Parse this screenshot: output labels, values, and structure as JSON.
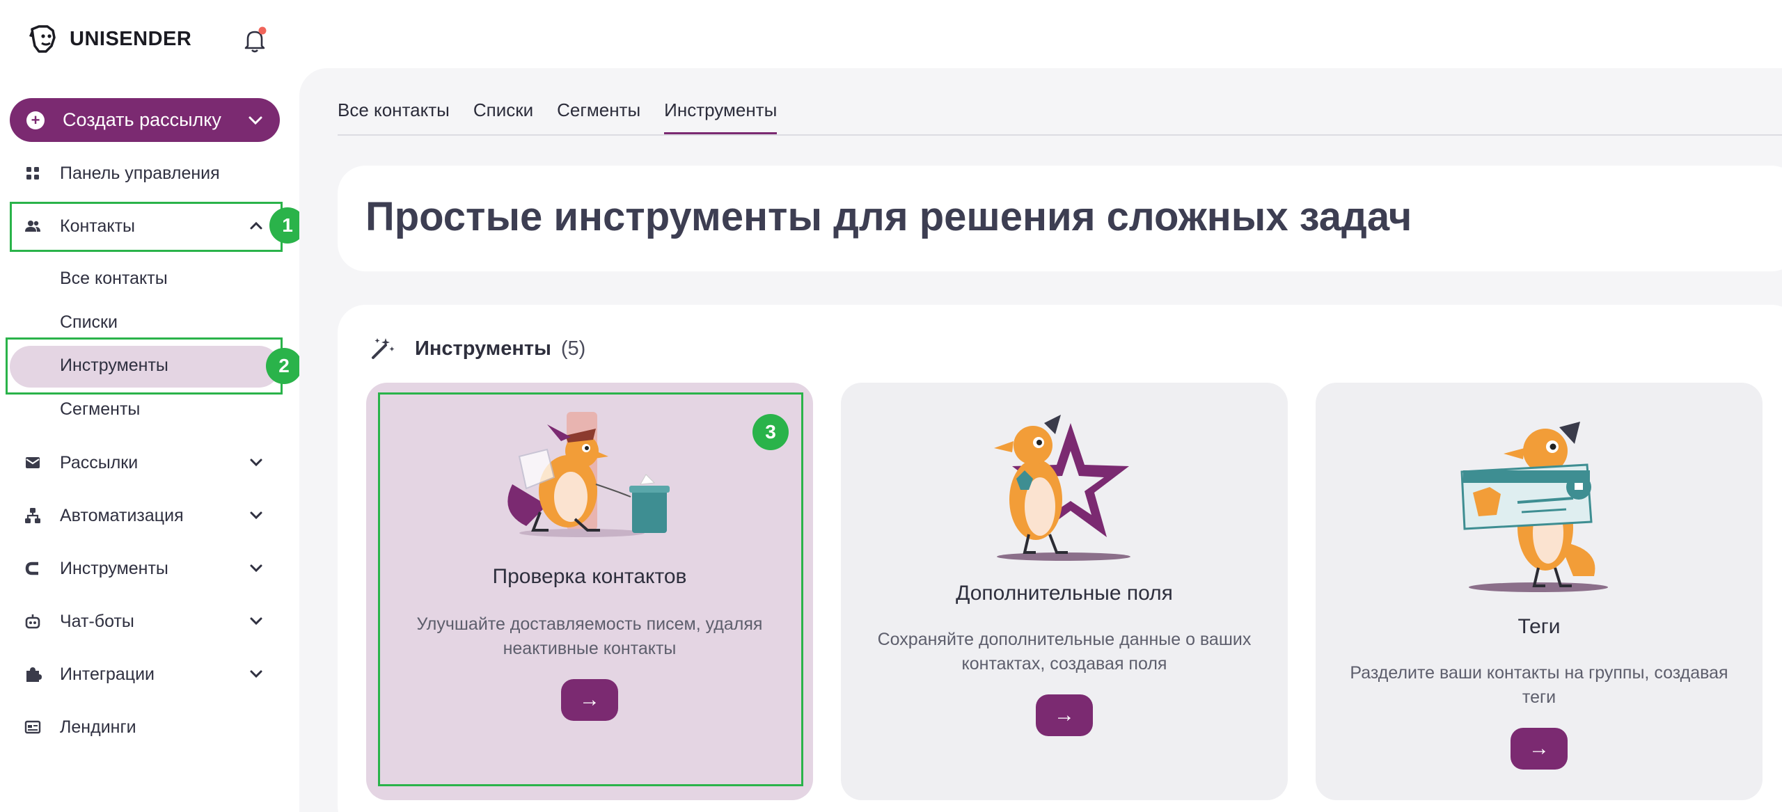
{
  "app": {
    "brand": "UNISENDER"
  },
  "sidebar": {
    "create_label": "Создать рассылку",
    "items": [
      {
        "label": "Панель управления"
      },
      {
        "label": "Контакты"
      },
      {
        "label": "Рассылки"
      },
      {
        "label": "Автоматизация"
      },
      {
        "label": "Инструменты"
      },
      {
        "label": "Чат-боты"
      },
      {
        "label": "Интеграции"
      },
      {
        "label": "Лендинги"
      }
    ],
    "contacts_sub": [
      {
        "label": "Все контакты"
      },
      {
        "label": "Списки"
      },
      {
        "label": "Инструменты"
      },
      {
        "label": "Сегменты"
      }
    ]
  },
  "annotations": {
    "b1": "1",
    "b2": "2",
    "b3": "3",
    "color": "#2ab34a"
  },
  "tabs": [
    {
      "label": "Все контакты"
    },
    {
      "label": "Списки"
    },
    {
      "label": "Сегменты"
    },
    {
      "label": "Инструменты",
      "active": true
    }
  ],
  "hero": {
    "title": "Простые инструменты для решения сложных задач"
  },
  "tools": {
    "title": "Инструменты",
    "count": "(5)",
    "cards": [
      {
        "title": "Проверка контактов",
        "desc": "Улучшайте доставляемость писем, удаляя неактивные контакты",
        "arrow": "→"
      },
      {
        "title": "Дополнительные поля",
        "desc": "Сохраняйте дополнительные данные о ваших контактах, создавая поля",
        "arrow": "→"
      },
      {
        "title": "Теги",
        "desc": "Разделите ваши контакты на группы, создавая теги",
        "arrow": "→"
      }
    ]
  },
  "colors": {
    "accent": "#7b2a71",
    "active_bg": "#e4d5e3",
    "annotation": "#2ab34a"
  }
}
